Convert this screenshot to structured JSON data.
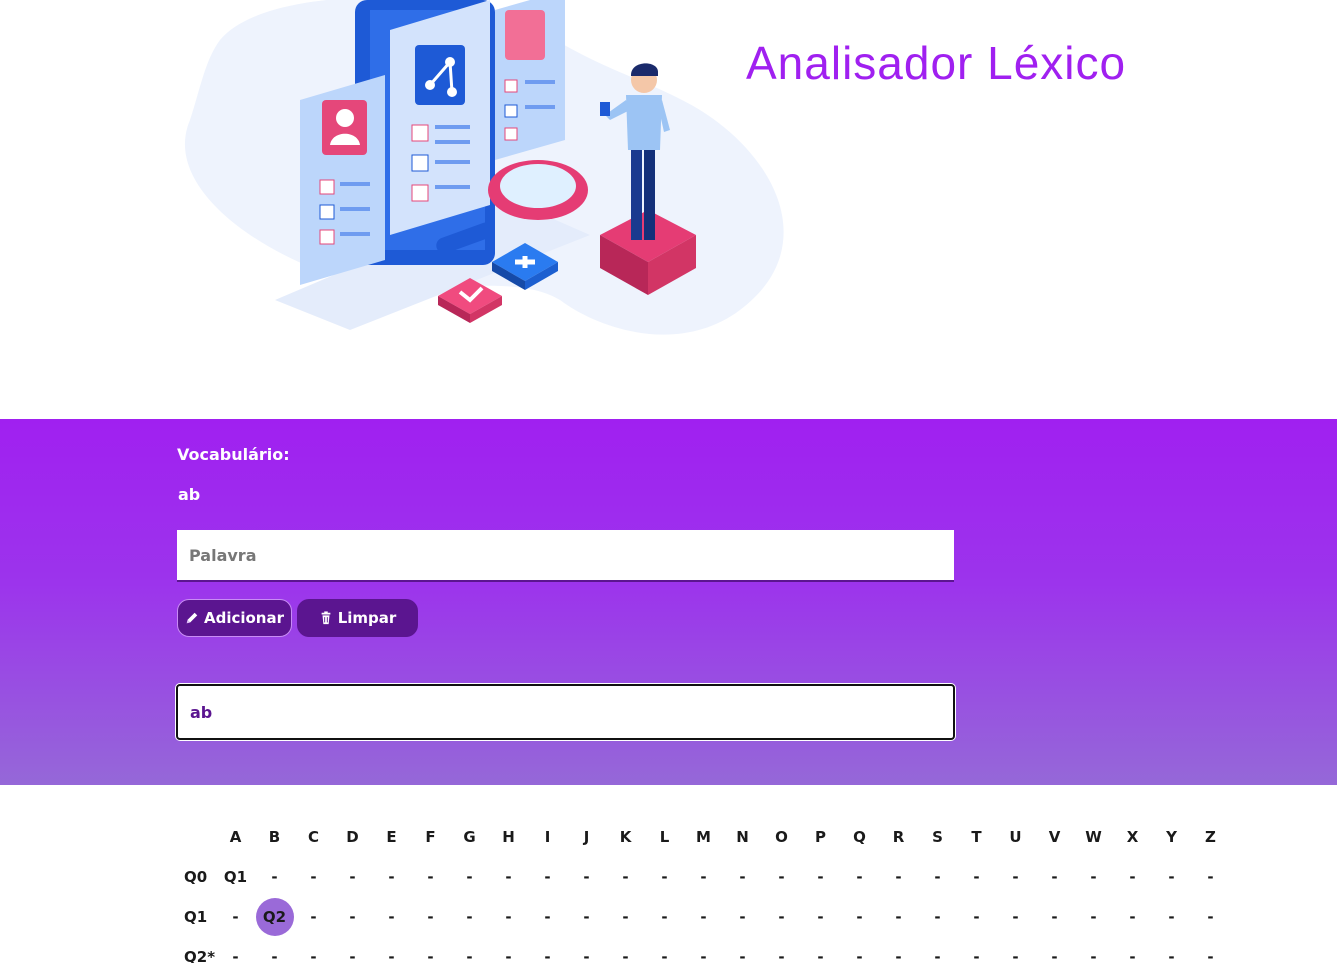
{
  "header": {
    "title": "Analisador Léxico",
    "title_color": "#a020f0"
  },
  "vocabulary": {
    "label": "Vocabulário:",
    "words": "ab"
  },
  "word_input": {
    "placeholder": "Palavra",
    "value": ""
  },
  "buttons": {
    "add_label": "Adicionar",
    "add_icon": "pencil-icon",
    "clear_label": "Limpar",
    "clear_icon": "trash-icon"
  },
  "test_input": {
    "value": "ab"
  },
  "table": {
    "columns": [
      "A",
      "B",
      "C",
      "D",
      "E",
      "F",
      "G",
      "H",
      "I",
      "J",
      "K",
      "L",
      "M",
      "N",
      "O",
      "P",
      "Q",
      "R",
      "S",
      "T",
      "U",
      "V",
      "W",
      "X",
      "Y",
      "Z"
    ],
    "rows": [
      {
        "state": "Q0",
        "cells": [
          "Q1",
          "-",
          "-",
          "-",
          "-",
          "-",
          "-",
          "-",
          "-",
          "-",
          "-",
          "-",
          "-",
          "-",
          "-",
          "-",
          "-",
          "-",
          "-",
          "-",
          "-",
          "-",
          "-",
          "-",
          "-",
          "-"
        ]
      },
      {
        "state": "Q1",
        "cells": [
          "-",
          "Q2",
          "-",
          "-",
          "-",
          "-",
          "-",
          "-",
          "-",
          "-",
          "-",
          "-",
          "-",
          "-",
          "-",
          "-",
          "-",
          "-",
          "-",
          "-",
          "-",
          "-",
          "-",
          "-",
          "-",
          "-"
        ]
      },
      {
        "state": "Q2*",
        "cells": [
          "-",
          "-",
          "-",
          "-",
          "-",
          "-",
          "-",
          "-",
          "-",
          "-",
          "-",
          "-",
          "-",
          "-",
          "-",
          "-",
          "-",
          "-",
          "-",
          "-",
          "-",
          "-",
          "-",
          "-",
          "-",
          "-"
        ]
      }
    ],
    "highlight": {
      "row": 1,
      "col": 1
    }
  },
  "colors": {
    "band_top": "#a020f0",
    "band_bottom": "#9568d8",
    "button_bg": "#5b1590",
    "highlight": "#9a6ad8"
  }
}
